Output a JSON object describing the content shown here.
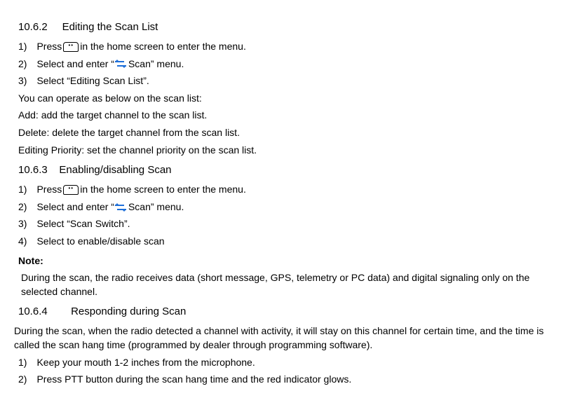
{
  "s1": {
    "heading_num": "10.6.2",
    "heading_text": "Editing the Scan List",
    "items": [
      {
        "n": "1)",
        "pre": "Press",
        "post": " in the home screen to enter the menu.",
        "icon": "menu"
      },
      {
        "n": "2)",
        "pre": "Select and enter “",
        "post": " Scan” menu.",
        "icon": "scan"
      },
      {
        "n": "3)",
        "text": "Select “Editing Scan List”."
      }
    ],
    "intro": "You can operate as below on the scan list:",
    "ops": [
      "Add: add the target channel to the scan list.",
      "Delete: delete the target channel from the scan list.",
      "Editing Priority: set the channel priority on the scan list."
    ]
  },
  "s2": {
    "heading_num": "10.6.3",
    "heading_text": "Enabling/disabling Scan",
    "items": [
      {
        "n": "1)",
        "pre": "Press",
        "post": " in the home screen to enter the menu.",
        "icon": "menu"
      },
      {
        "n": "2)",
        "pre": "Select and enter “",
        "post": " Scan” menu.",
        "icon": "scan"
      },
      {
        "n": "3)",
        "text": "Select “Scan Switch”."
      },
      {
        "n": "4)",
        "text": "Select to enable/disable scan"
      }
    ],
    "note_label": "Note:",
    "note_body": "During the scan, the radio receives data (short message, GPS, telemetry or PC data) and digital signaling only on the selected channel."
  },
  "s3": {
    "heading_num": "10.6.4",
    "heading_text": "Responding during Scan",
    "intro": "During the scan, when the radio detected a channel with activity, it will stay on this channel for certain time, and the time is called the scan hang time (programmed by dealer through programming software).",
    "items": [
      {
        "n": "1)",
        "text": "Keep your mouth 1-2 inches from the microphone."
      },
      {
        "n": "2)",
        "text": "Press PTT button during the scan hang time and the red indicator glows."
      }
    ]
  }
}
